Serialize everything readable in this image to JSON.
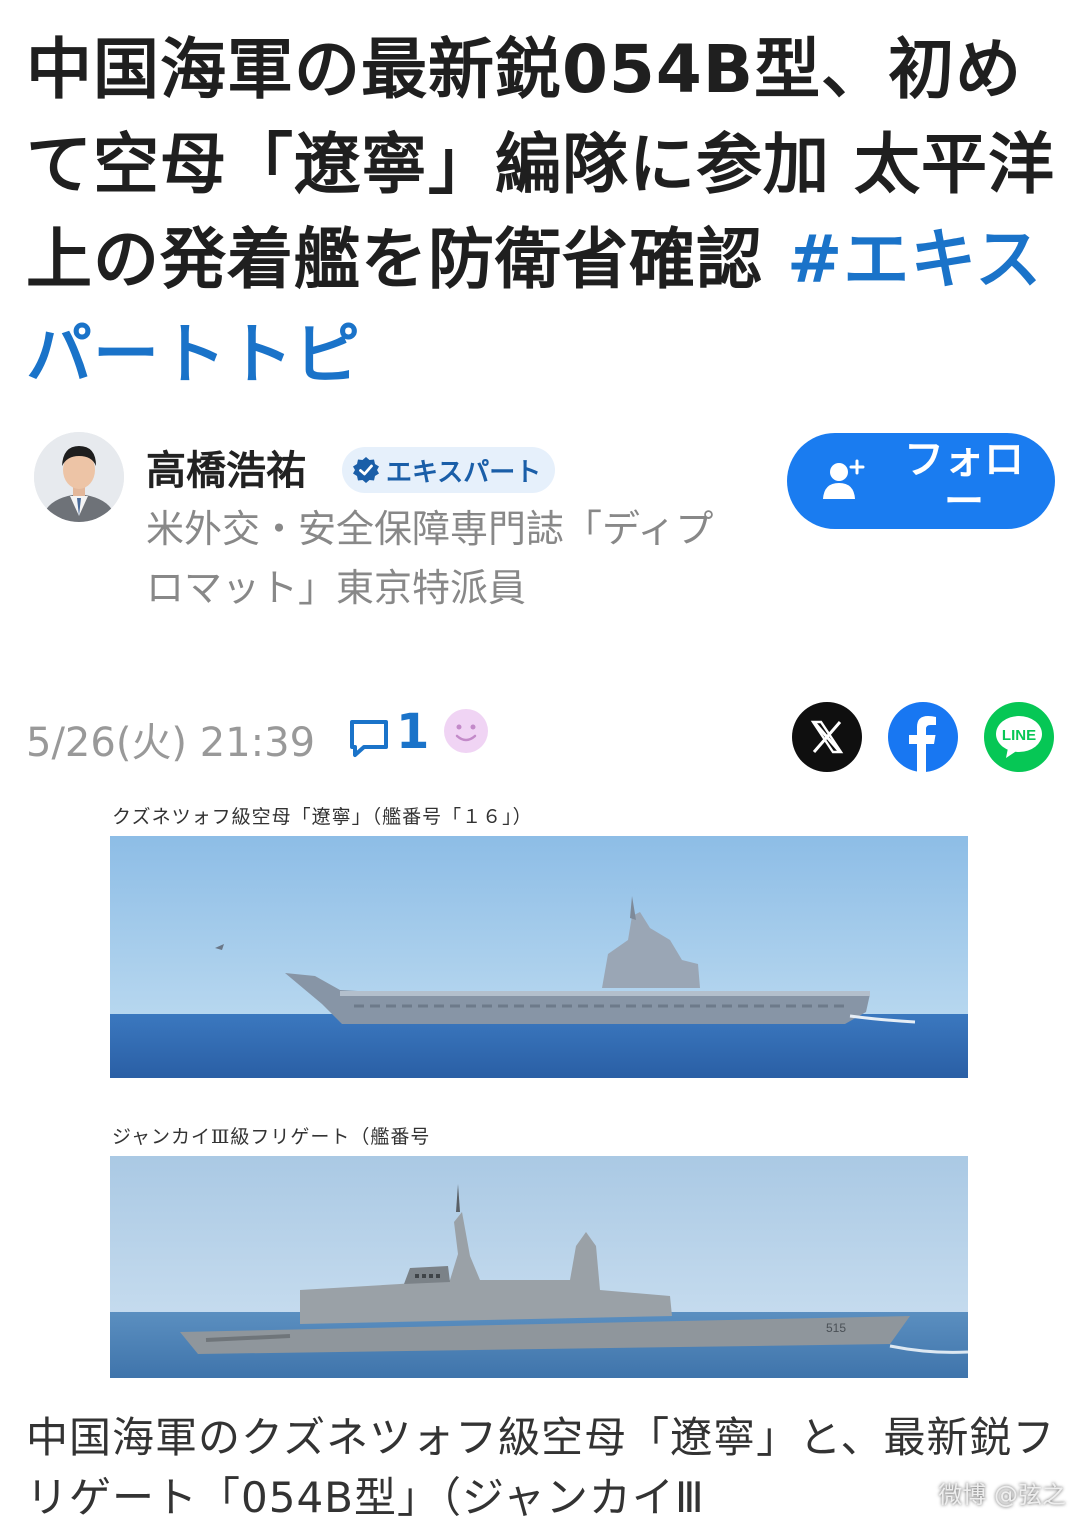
{
  "article": {
    "title": "中国海軍の最新鋭054B型、初めて空母「遼寧」編隊に参加 太平洋上の発着艦を防衛省確認",
    "hashtag": "#エキスパートトピ"
  },
  "author": {
    "name": "高橋浩祐",
    "badge": "エキスパート",
    "description": "米外交・安全保障専門誌「ディプロマット」東京特派員",
    "follow_label": "フォロー"
  },
  "meta": {
    "date": "5/26(火) 21:39",
    "comment_count": "1"
  },
  "share": {
    "line_label": "LINE"
  },
  "figure": {
    "caption_top": "クズネツォフ級空母「遼寧」（艦番号「１６」）",
    "caption_bottom": "ジャンカイⅢ級フリゲート（艦番号",
    "hull_number": "515"
  },
  "body": {
    "text": "中国海軍のクズネツォフ級空母「遼寧」と、最新鋭フリゲート「054B型」（ジャンカイⅢ"
  },
  "watermark": "微博 @弦之",
  "colors": {
    "accent": "#1a73c9",
    "follow": "#1a7cf0",
    "x": "#0f0f0f",
    "facebook": "#1877f2",
    "line": "#06c755"
  },
  "icons": [
    "verified-check-icon",
    "add-person-icon",
    "comment-icon",
    "smile-reaction-icon",
    "x-logo-icon",
    "facebook-logo-icon",
    "line-logo-icon"
  ]
}
